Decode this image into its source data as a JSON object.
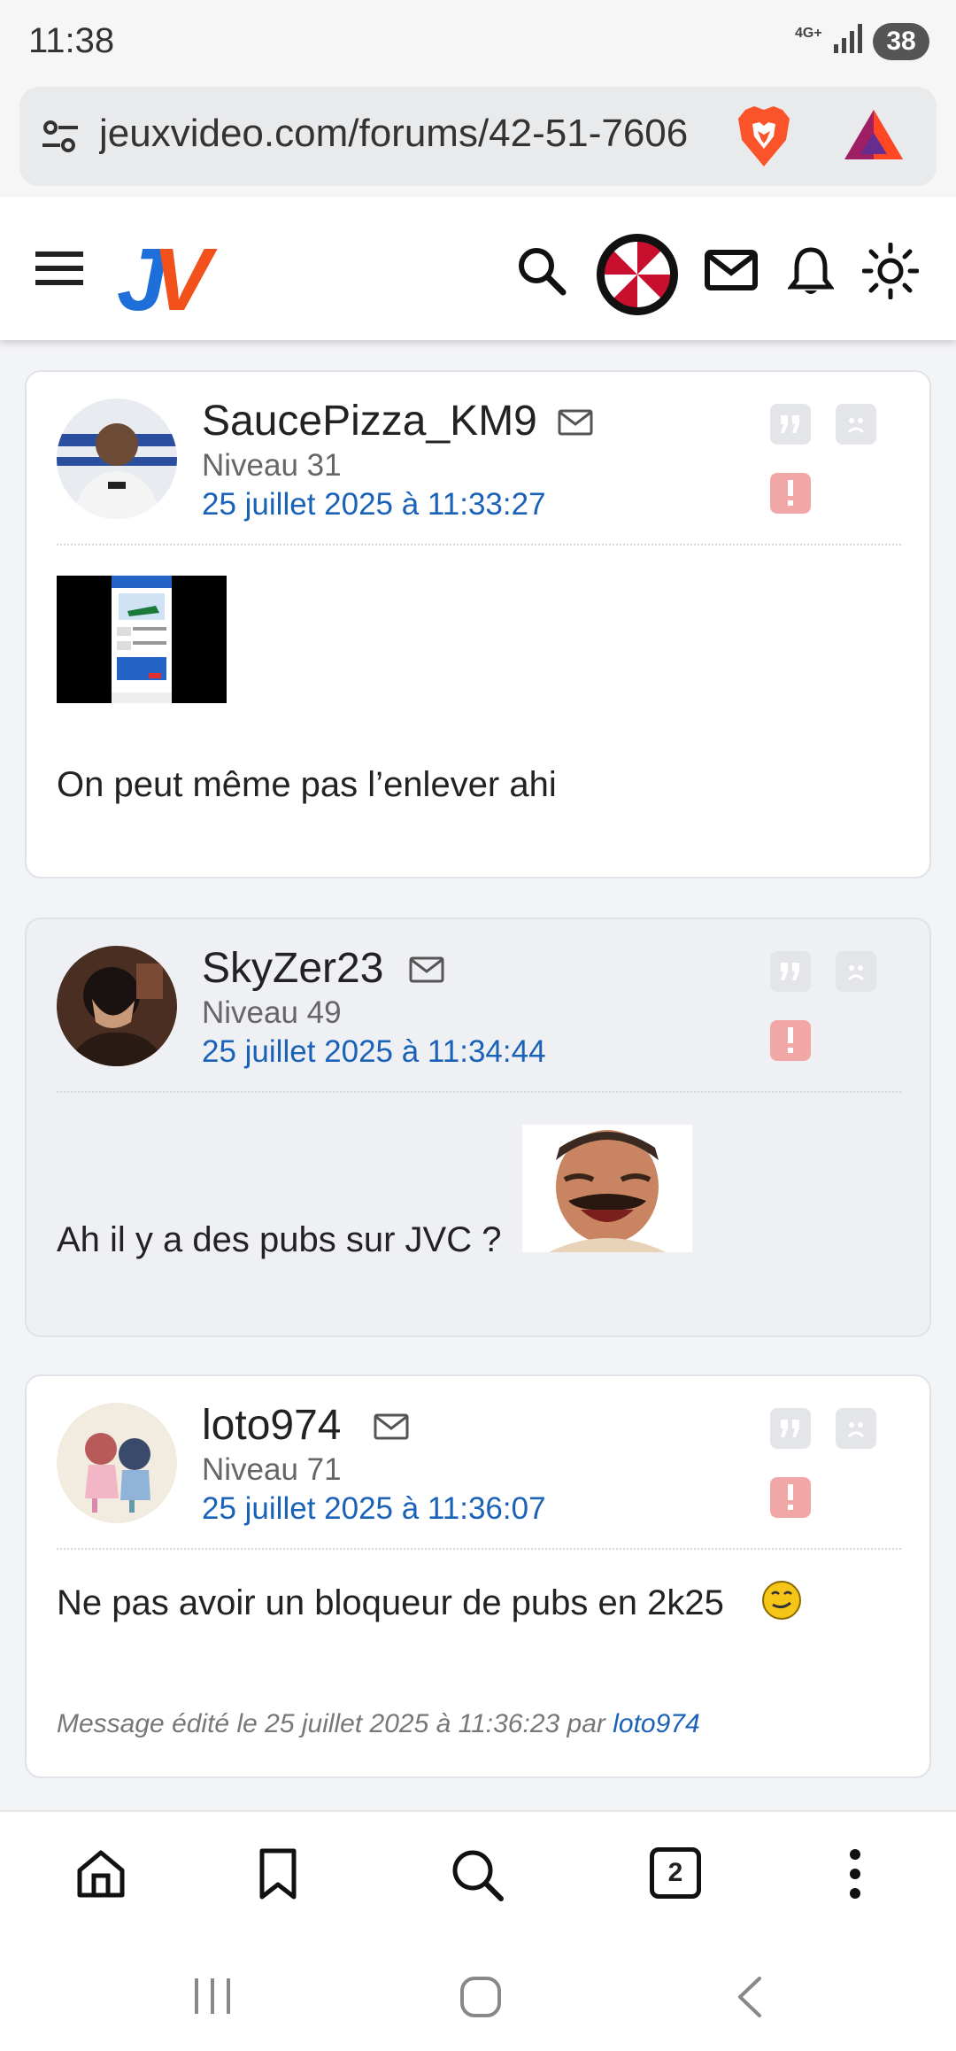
{
  "status": {
    "time": "11:38",
    "network": "4G+",
    "battery": "38"
  },
  "browser": {
    "url": "jeuxvideo.com/forums/42-51-7606",
    "tab_count": "2"
  },
  "header": {
    "logo_j": "J",
    "logo_v": "V"
  },
  "posts": [
    {
      "username": "SaucePizza_KM9",
      "level": "Niveau 31",
      "date": "25 juillet 2025 à 11:33:27",
      "text": "On peut même pas l’enlever ahi"
    },
    {
      "username": "SkyZer23",
      "level": "Niveau 49",
      "date": "25 juillet 2025 à 11:34:44",
      "text": "Ah il y a des pubs sur JVC ?"
    },
    {
      "username": "loto974",
      "level": "Niveau 71",
      "date": "25 juillet 2025 à 11:36:07",
      "text": "Ne pas avoir un bloqueur de pubs en 2k25",
      "edited_prefix": "Message édité le 25 juillet 2025 à 11:36:23 par ",
      "edited_by": "loto974"
    }
  ],
  "colors": {
    "link_blue": "#1a62b8",
    "report_red": "#f2a7a7",
    "logo_blue": "#1e6fd9",
    "logo_orange": "#f2511b"
  }
}
